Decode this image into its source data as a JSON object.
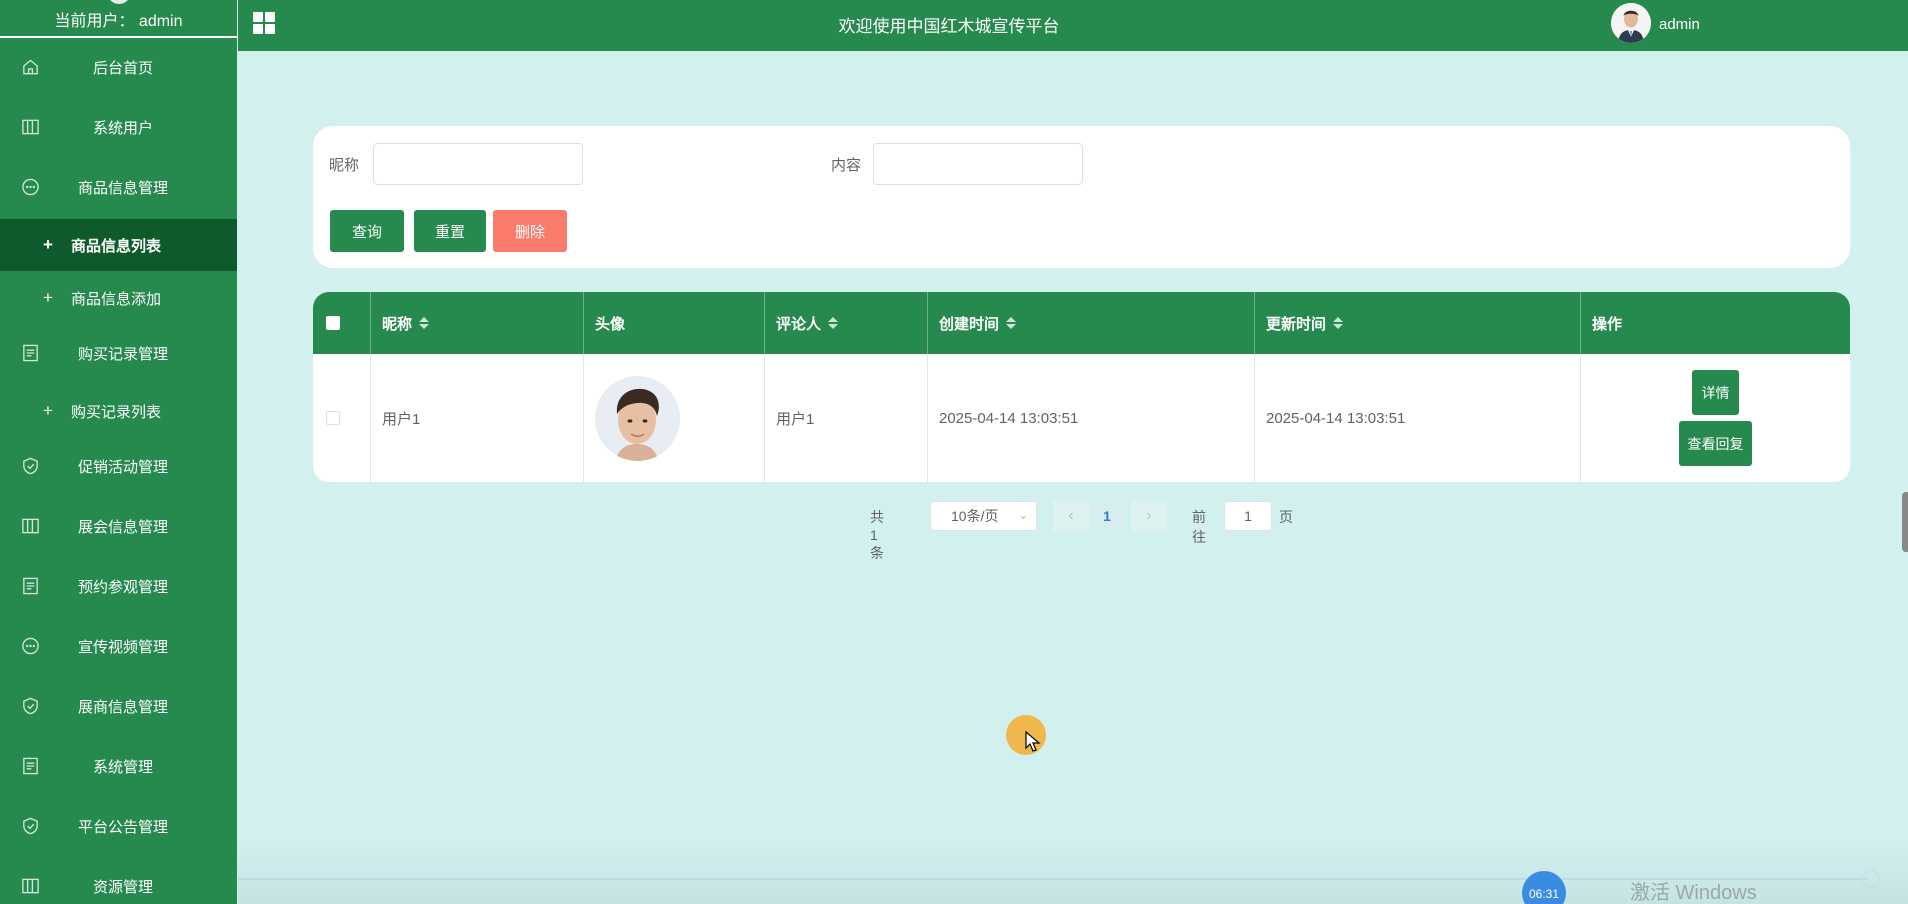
{
  "sidebar": {
    "current_user": "当前用户：  admin",
    "items": [
      {
        "label": "后台首页",
        "icon": "home-icon"
      },
      {
        "label": "系统用户",
        "icon": "columns-icon"
      },
      {
        "label": "商品信息管理",
        "icon": "chat-icon"
      },
      {
        "label": "购买记录管理",
        "icon": "document-icon"
      },
      {
        "label": "促销活动管理",
        "icon": "shield-check-icon"
      },
      {
        "label": "展会信息管理",
        "icon": "columns-icon"
      },
      {
        "label": "预约参观管理",
        "icon": "document-icon"
      },
      {
        "label": "宣传视频管理",
        "icon": "chat-icon"
      },
      {
        "label": "展商信息管理",
        "icon": "shield-check-icon"
      },
      {
        "label": "系统管理",
        "icon": "document-icon"
      },
      {
        "label": "平台公告管理",
        "icon": "shield-check-icon"
      },
      {
        "label": "资源管理",
        "icon": "columns-icon"
      }
    ],
    "subitems": [
      {
        "label": "商品信息列表",
        "active": true
      },
      {
        "label": "商品信息添加",
        "active": false
      },
      {
        "label": "购买记录列表",
        "active": false
      }
    ]
  },
  "header": {
    "title": "欢迎使用中国红木城宣传平台",
    "username": "admin"
  },
  "search": {
    "nickname_label": "昵称",
    "nickname_value": "",
    "content_label": "内容",
    "content_value": "",
    "query_label": "查询",
    "reset_label": "重置",
    "delete_label": "删除"
  },
  "table": {
    "columns": [
      "昵称",
      "头像",
      "评论人",
      "创建时间",
      "更新时间",
      "操作"
    ],
    "rows": [
      {
        "nickname": "用户1",
        "commenter": "用户1",
        "created": "2025-04-14 13:03:51",
        "updated": "2025-04-14 13:03:51",
        "detail_label": "详情",
        "reply_label": "查看回复"
      }
    ]
  },
  "pagination": {
    "total_text": "共 1 条",
    "page_size": "10条/页",
    "current_page": "1",
    "goto_label": "前往",
    "goto_value": "1",
    "page_suffix": "页"
  },
  "overlay": {
    "video_time": "06:31",
    "watermark": "激活 Windows"
  },
  "colors": {
    "primary": "#26894e",
    "active_menu": "#0e5a2d",
    "danger": "#fa7b6b",
    "background": "#d2f0ee"
  }
}
